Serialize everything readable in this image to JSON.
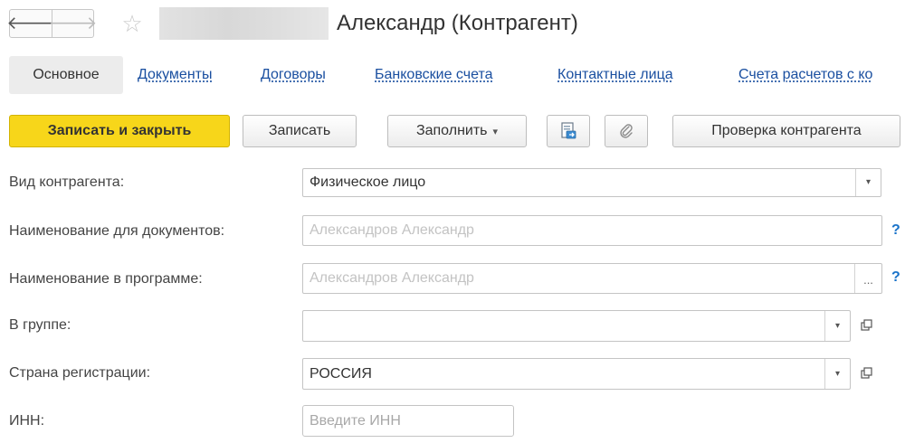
{
  "header": {
    "back_icon": "arrow-left-icon",
    "forward_icon": "arrow-right-icon",
    "favorite_icon": "star-icon",
    "title": "Александр (Контрагент)"
  },
  "tabs": [
    {
      "label": "Основное",
      "active": true
    },
    {
      "label": "Документы"
    },
    {
      "label": "Договоры"
    },
    {
      "label": "Банковские счета"
    },
    {
      "label": "Контактные лица"
    },
    {
      "label": "Счета расчетов с ко"
    }
  ],
  "toolbar": {
    "save_close_label": "Записать и закрыть",
    "save_label": "Записать",
    "fill_label": "Заполнить",
    "fill_caret": "▾",
    "report_icon": "document-print-icon",
    "attach_icon": "paperclip-icon",
    "check_label": "Проверка контрагента"
  },
  "form": {
    "kind": {
      "label": "Вид контрагента:",
      "value": "Физическое лицо"
    },
    "doc_name": {
      "label": "Наименование для документов:",
      "value": "Александров Александр",
      "help": "?"
    },
    "prog_name": {
      "label": "Наименование в программе:",
      "value": "Александров Александр",
      "ellipsis": "...",
      "help": "?"
    },
    "group": {
      "label": "В группе:",
      "value": ""
    },
    "country": {
      "label": "Страна регистрации:",
      "value": "РОССИЯ"
    },
    "inn": {
      "label": "ИНН:",
      "placeholder": "Введите ИНН"
    }
  },
  "colors": {
    "accent_yellow": "#f7d61a",
    "link_blue": "#1a4fa0",
    "help_blue": "#1a73c9"
  }
}
